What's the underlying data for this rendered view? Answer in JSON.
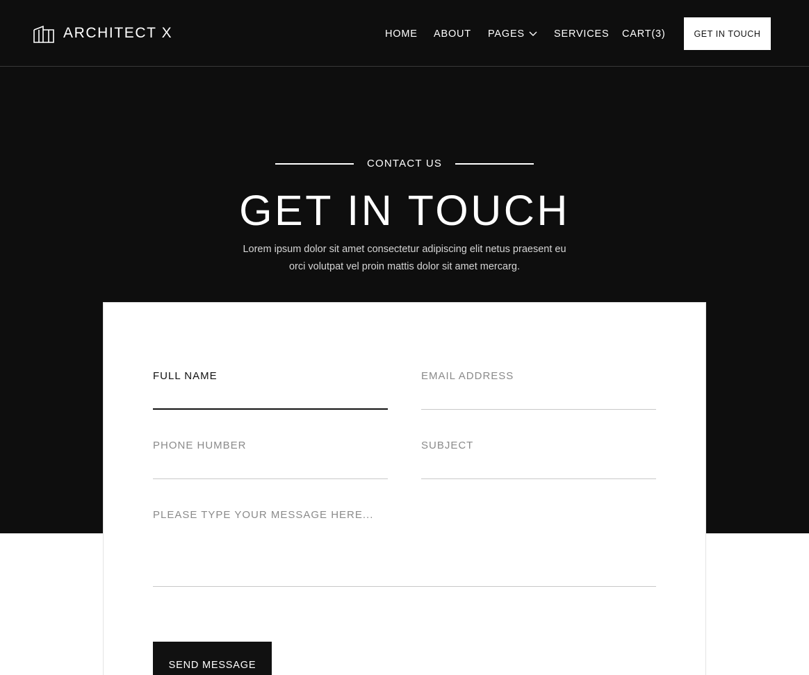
{
  "header": {
    "logo_text": "ARCHITECT X",
    "logo_icon": "building-icon",
    "nav": {
      "home": "HOME",
      "about": "ABOUT",
      "pages": "PAGES",
      "services": "SERVICES",
      "cart": "CART(3)"
    },
    "cta_label": "GET IN TOUCH"
  },
  "hero": {
    "eyebrow": "CONTACT US",
    "title": "GET IN TOUCH",
    "intro_line1": "Lorem ipsum dolor sit amet consectetur adipiscing elit netus praesent eu",
    "intro_line2": "orci volutpat vel proin mattis dolor sit amet mercarg."
  },
  "form": {
    "full_name_label": "FULL NAME",
    "email_label": "EMAIL ADDRESS",
    "phone_label": "PHONE HUMBER",
    "subject_label": "SUBJECT",
    "message_placeholder": "PLEASE TYPE YOUR MESSAGE HERE...",
    "submit_label": "SEND MESSAGE"
  },
  "colors": {
    "hero_background": "#0e0e0e",
    "accent": "#111111",
    "muted_text": "#8a8a8a"
  }
}
